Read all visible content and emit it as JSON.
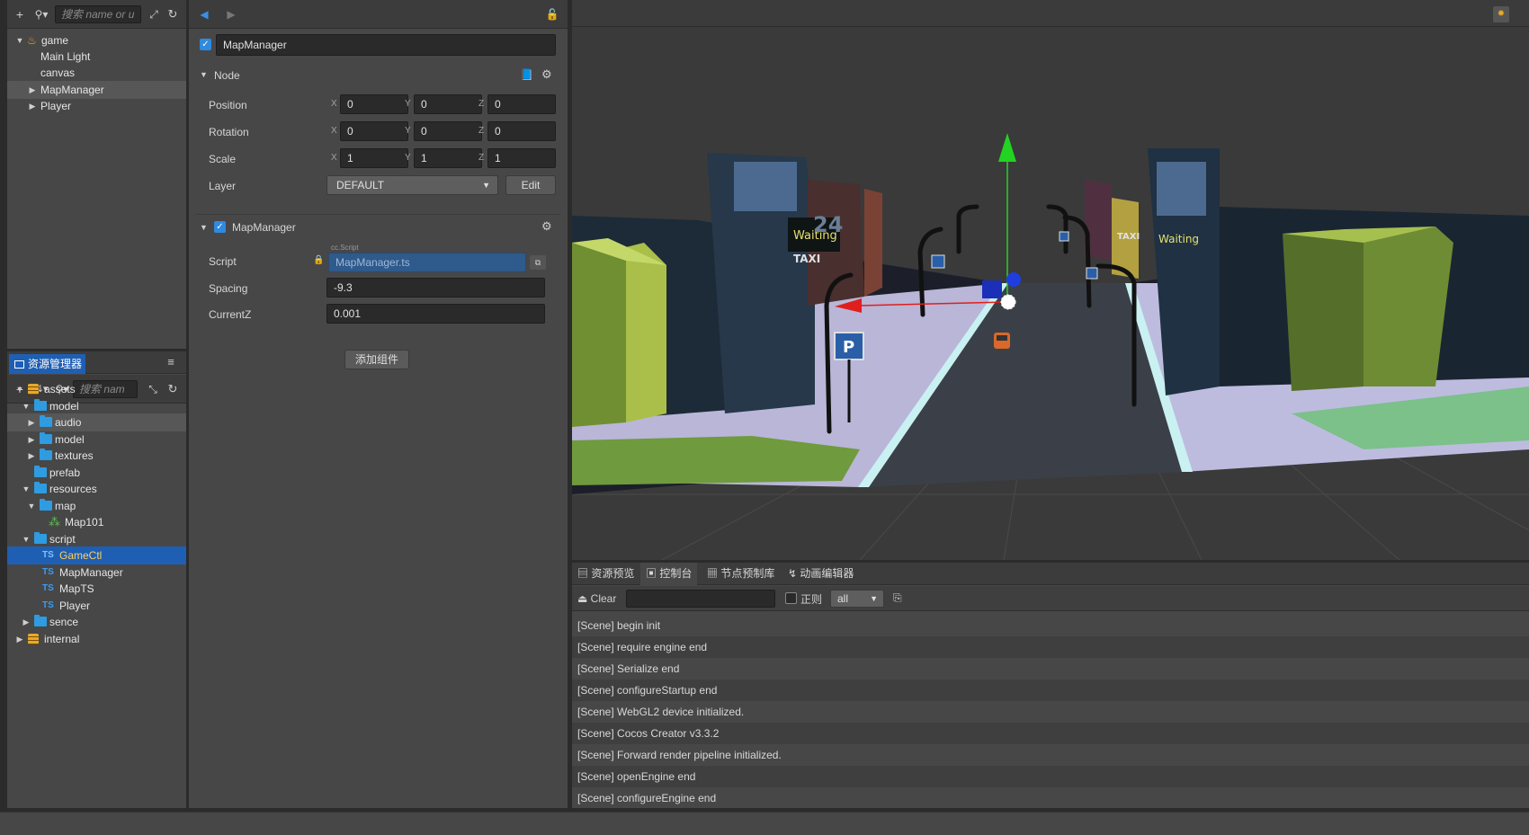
{
  "hierarchy": {
    "search_placeholder": "搜索 name or u",
    "items": [
      {
        "label": "game",
        "icon": "flame-icon",
        "expanded": true
      },
      {
        "label": "Main Light"
      },
      {
        "label": "canvas"
      },
      {
        "label": "MapManager",
        "collapsed": true,
        "highlighted": true
      },
      {
        "label": "Player",
        "collapsed": true
      }
    ]
  },
  "assets": {
    "title": "资源管理器",
    "search_placeholder": "搜索 nam",
    "items": [
      {
        "label": "assets"
      },
      {
        "label": "model"
      },
      {
        "label": "audio"
      },
      {
        "label": "model"
      },
      {
        "label": "textures"
      },
      {
        "label": "prefab"
      },
      {
        "label": "resources"
      },
      {
        "label": "map"
      },
      {
        "label": "Map101"
      },
      {
        "label": "script"
      },
      {
        "label": "GameCtl",
        "selected": true
      },
      {
        "label": "MapManager"
      },
      {
        "label": "MapTS"
      },
      {
        "label": "Player"
      },
      {
        "label": "sence"
      },
      {
        "label": "internal"
      }
    ],
    "ts_tag": "TS"
  },
  "inspector": {
    "node_name": "MapManager",
    "node_section": "Node",
    "position": {
      "label": "Position",
      "x": "0",
      "y": "0",
      "z": "0"
    },
    "rotation": {
      "label": "Rotation",
      "x": "0",
      "y": "0",
      "z": "0"
    },
    "scale": {
      "label": "Scale",
      "x": "1",
      "y": "1",
      "z": "1"
    },
    "axis": {
      "x": "X",
      "y": "Y",
      "z": "Z"
    },
    "layer": {
      "label": "Layer",
      "value": "DEFAULT",
      "edit": "Edit"
    },
    "component": {
      "title": "MapManager",
      "script_tag": "cc.Script",
      "script_label": "Script",
      "script_value": "MapManager.ts",
      "spacing_label": "Spacing",
      "spacing_value": "-9.3",
      "currentz_label": "CurrentZ",
      "currentz_value": "0.001"
    },
    "add_component": "添加组件"
  },
  "scene": {
    "signs": {
      "waiting": "Waiting",
      "taxi": "TAXI",
      "parking": "P",
      "number": "24"
    }
  },
  "console": {
    "tabs": [
      "资源预览",
      "控制台",
      "节点预制库",
      "动画编辑器"
    ],
    "clear": "Clear",
    "regex_label": "正则",
    "filter_value": "all",
    "logs": [
      "[Scene] begin init",
      "[Scene] require engine end",
      "[Scene] Serialize end",
      "[Scene] configureStartup end",
      "[Scene] WebGL2 device initialized.",
      "[Scene] Cocos Creator v3.3.2",
      "[Scene] Forward render pipeline initialized.",
      "[Scene] openEngine end",
      "[Scene] configureEngine end"
    ]
  },
  "colors": {
    "accent": "#1f5fb3",
    "folder": "#2f9be0",
    "panel": "#474747"
  }
}
